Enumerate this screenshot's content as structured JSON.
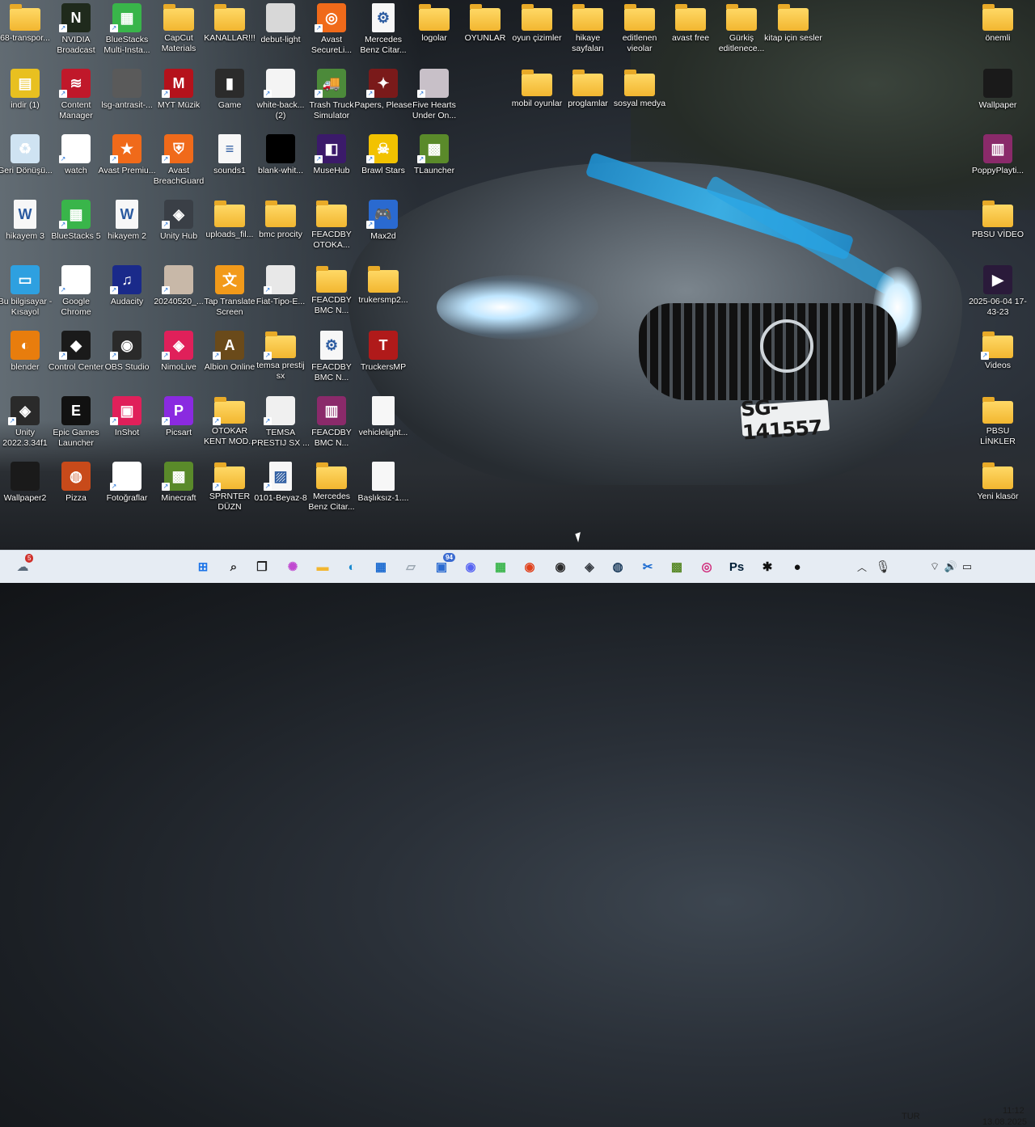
{
  "desktop": {
    "icons": [
      {
        "label": "68-transpor...",
        "kind": "folder",
        "bg": "#f2b630",
        "symbol": ""
      },
      {
        "label": "NVIDIA Broadcast",
        "kind": "app",
        "bg": "#1f2a1c",
        "symbol": "N"
      },
      {
        "label": "BlueStacks Multi-Insta...",
        "kind": "app",
        "bg": "#39b54a",
        "symbol": "▦"
      },
      {
        "label": "CapCut Materials",
        "kind": "folder",
        "bg": "#f2b630",
        "symbol": ""
      },
      {
        "label": "KANALLAR!!!",
        "kind": "folder",
        "bg": "#f2b630",
        "symbol": ""
      },
      {
        "label": "debut-light",
        "kind": "app",
        "bg": "#d8d8d8",
        "symbol": ""
      },
      {
        "label": "Avast SecureLi...",
        "kind": "app",
        "bg": "#f06a1a",
        "symbol": "◎"
      },
      {
        "label": "Mercedes Benz Citar...",
        "kind": "doc",
        "bg": "#f7f7f7",
        "symbol": "⚙"
      },
      {
        "label": "logolar",
        "kind": "folder",
        "bg": "#f2b630",
        "symbol": ""
      },
      {
        "label": "OYUNLAR",
        "kind": "folder",
        "bg": "#f2b630",
        "symbol": ""
      },
      {
        "label": "oyun çizimler",
        "kind": "folder",
        "bg": "#f2b630",
        "symbol": ""
      },
      {
        "label": "hikaye sayfaları",
        "kind": "folder",
        "bg": "#f2b630",
        "symbol": ""
      },
      {
        "label": "editlenen vieolar",
        "kind": "folder",
        "bg": "#f2b630",
        "symbol": ""
      },
      {
        "label": "avast free",
        "kind": "folder",
        "bg": "#f2b630",
        "symbol": ""
      },
      {
        "label": "Gürkiş editlenece...",
        "kind": "folder",
        "bg": "#f2b630",
        "symbol": ""
      },
      {
        "label": "kitap için sesler",
        "kind": "folder",
        "bg": "#f2b630",
        "symbol": ""
      },
      {
        "label": "önemli",
        "kind": "folder",
        "bg": "#f2b630",
        "symbol": ""
      },
      {
        "label": "indir (1)",
        "kind": "app",
        "bg": "#e8c020",
        "symbol": "▤"
      },
      {
        "label": "Content Manager",
        "kind": "app",
        "bg": "#c0182a",
        "symbol": "≋"
      },
      {
        "label": "lsg-antrasit-...",
        "kind": "app",
        "bg": "#5a5a5a",
        "symbol": ""
      },
      {
        "label": "MYT Müzik",
        "kind": "app",
        "bg": "#b5121b",
        "symbol": "M"
      },
      {
        "label": "Game",
        "kind": "app",
        "bg": "#2b2b2b",
        "symbol": "▮"
      },
      {
        "label": "white-back... (2)",
        "kind": "app",
        "bg": "#f4f4f4",
        "symbol": ""
      },
      {
        "label": "Trash Truck Simulator",
        "kind": "app",
        "bg": "#4c8a3a",
        "symbol": "🚚"
      },
      {
        "label": "Papers, Please",
        "kind": "app",
        "bg": "#7a1a1a",
        "symbol": "✦"
      },
      {
        "label": "Five Hearts Under On...",
        "kind": "app",
        "bg": "#c8c0c8",
        "symbol": ""
      },
      {
        "label": "mobil oyunlar",
        "kind": "folder",
        "bg": "#f2b630",
        "symbol": ""
      },
      {
        "label": "proglamlar",
        "kind": "folder",
        "bg": "#f2b630",
        "symbol": ""
      },
      {
        "label": "sosyal medya",
        "kind": "folder",
        "bg": "#f2b630",
        "symbol": ""
      },
      {
        "label": "Wallpaper",
        "kind": "app",
        "bg": "#1a1a1a",
        "symbol": ""
      },
      {
        "label": "Geri Dönüşü...",
        "kind": "app",
        "bg": "#cfe3f2",
        "symbol": "♻"
      },
      {
        "label": "watch",
        "kind": "app",
        "bg": "#ffffff",
        "symbol": "◉"
      },
      {
        "label": "Avast Premiu...",
        "kind": "app",
        "bg": "#f06a1a",
        "symbol": "★"
      },
      {
        "label": "Avast BreachGuard",
        "kind": "app",
        "bg": "#f06a1a",
        "symbol": "⛨"
      },
      {
        "label": "sounds1",
        "kind": "doc",
        "bg": "#f7f7f7",
        "symbol": "≡"
      },
      {
        "label": "blank-whit...",
        "kind": "app",
        "bg": "#000000",
        "symbol": ""
      },
      {
        "label": "MuseHub",
        "kind": "app",
        "bg": "#3b1a6a",
        "symbol": "◧"
      },
      {
        "label": "Brawl Stars",
        "kind": "app",
        "bg": "#f2c200",
        "symbol": "☠"
      },
      {
        "label": "TLauncher",
        "kind": "app",
        "bg": "#5a8a2a",
        "symbol": "▩"
      },
      {
        "label": "PoppyPlayti...",
        "kind": "app",
        "bg": "#8a2a6a",
        "symbol": "▥"
      },
      {
        "label": "hikayem 3",
        "kind": "doc",
        "bg": "#f7f7f7",
        "symbol": "W"
      },
      {
        "label": "BlueStacks 5",
        "kind": "app",
        "bg": "#39b54a",
        "symbol": "▦"
      },
      {
        "label": "hikayem 2",
        "kind": "doc",
        "bg": "#f7f7f7",
        "symbol": "W"
      },
      {
        "label": "Unity Hub",
        "kind": "app",
        "bg": "#3a3f46",
        "symbol": "◈"
      },
      {
        "label": "uploads_fil...",
        "kind": "folder",
        "bg": "#f2b630",
        "symbol": ""
      },
      {
        "label": "bmc procity",
        "kind": "folder",
        "bg": "#f2b630",
        "symbol": ""
      },
      {
        "label": "FEACDBY OTOKA...",
        "kind": "folder",
        "bg": "#f2b630",
        "symbol": ""
      },
      {
        "label": "Max2d",
        "kind": "app",
        "bg": "#2a6ad0",
        "symbol": "🎮"
      },
      {
        "label": "PBSU VİDEO",
        "kind": "folder",
        "bg": "#f2b630",
        "symbol": ""
      },
      {
        "label": "Bu bilgisayar - Kısayol",
        "kind": "app",
        "bg": "#2ea0e0",
        "symbol": "▭"
      },
      {
        "label": "Google Chrome",
        "kind": "app",
        "bg": "#ffffff",
        "symbol": "◉"
      },
      {
        "label": "Audacity",
        "kind": "app",
        "bg": "#1a2a8a",
        "symbol": "♫"
      },
      {
        "label": "20240520_...",
        "kind": "app",
        "bg": "#c8b8a8",
        "symbol": ""
      },
      {
        "label": "Tap Translate Screen",
        "kind": "app",
        "bg": "#f29a1a",
        "symbol": "文"
      },
      {
        "label": "Fiat-Tipo-E...",
        "kind": "app",
        "bg": "#e8e8e8",
        "symbol": ""
      },
      {
        "label": "FEACDBY BMC N...",
        "kind": "folder",
        "bg": "#f2b630",
        "symbol": ""
      },
      {
        "label": "trukersmp2...",
        "kind": "folder",
        "bg": "#f2b630",
        "symbol": ""
      },
      {
        "label": "2025-06-04 17-43-23",
        "kind": "app",
        "bg": "#2a1a3a",
        "symbol": "▶"
      },
      {
        "label": "blender",
        "kind": "app",
        "bg": "#e87d0d",
        "symbol": "◐"
      },
      {
        "label": "Control Center",
        "kind": "app",
        "bg": "#1a1a1a",
        "symbol": "◆"
      },
      {
        "label": "OBS Studio",
        "kind": "app",
        "bg": "#2a2a2a",
        "symbol": "◉"
      },
      {
        "label": "NimoLive",
        "kind": "app",
        "bg": "#e0205a",
        "symbol": "◈"
      },
      {
        "label": "Albion Online",
        "kind": "app",
        "bg": "#6a4a1a",
        "symbol": "A"
      },
      {
        "label": "temsa prestij sx",
        "kind": "folder",
        "bg": "#f2b630",
        "symbol": ""
      },
      {
        "label": "FEACDBY BMC N...",
        "kind": "doc",
        "bg": "#f7f7f7",
        "symbol": "⚙"
      },
      {
        "label": "TruckersMP",
        "kind": "app",
        "bg": "#b01a1a",
        "symbol": "T"
      },
      {
        "label": "Videos",
        "kind": "folder",
        "bg": "#f2b630",
        "symbol": ""
      },
      {
        "label": "Unity 2022.3.34f1",
        "kind": "app",
        "bg": "#2a2a2a",
        "symbol": "◈"
      },
      {
        "label": "Epic Games Launcher",
        "kind": "app",
        "bg": "#111111",
        "symbol": "E"
      },
      {
        "label": "InShot",
        "kind": "app",
        "bg": "#e0205a",
        "symbol": "▣"
      },
      {
        "label": "Picsart",
        "kind": "app",
        "bg": "#8a2ae0",
        "symbol": "P"
      },
      {
        "label": "OTOKAR KENT MOD...",
        "kind": "folder",
        "bg": "#f2b630",
        "symbol": ""
      },
      {
        "label": "TEMSA PRESTIJ SX ...",
        "kind": "app",
        "bg": "#f0f0f0",
        "symbol": ""
      },
      {
        "label": "FEACDBY BMC N...",
        "kind": "app",
        "bg": "#8a2a6a",
        "symbol": "▥"
      },
      {
        "label": "vehiclelight...",
        "kind": "doc",
        "bg": "#f7f7f7",
        "symbol": ""
      },
      {
        "label": "PBSU LİNKLER",
        "kind": "folder",
        "bg": "#f2b630",
        "symbol": ""
      },
      {
        "label": "Wallpaper2",
        "kind": "app",
        "bg": "#1a1a1a",
        "symbol": ""
      },
      {
        "label": "Pizza",
        "kind": "app",
        "bg": "#c84a1a",
        "symbol": "◍"
      },
      {
        "label": "Fotoğraflar",
        "kind": "app",
        "bg": "#ffffff",
        "symbol": "✿"
      },
      {
        "label": "Minecraft",
        "kind": "app",
        "bg": "#5a8a2a",
        "symbol": "▩"
      },
      {
        "label": "SPRNTER DÜZN",
        "kind": "folder",
        "bg": "#f2b630",
        "symbol": ""
      },
      {
        "label": "0101-Beyaz-8",
        "kind": "doc",
        "bg": "#f7f7f7",
        "symbol": "▨"
      },
      {
        "label": "Mercedes Benz Citar...",
        "kind": "folder",
        "bg": "#f2b630",
        "symbol": ""
      },
      {
        "label": "Başlıksız-1....",
        "kind": "doc",
        "bg": "#f7f7f7",
        "symbol": ""
      },
      {
        "label": "Yeni klasör",
        "kind": "folder",
        "bg": "#f2b630",
        "symbol": ""
      }
    ]
  },
  "wallpaper": {
    "plate": "SG-141557"
  },
  "taskbar": {
    "weather_badge": "5",
    "apps": [
      {
        "name": "start-icon",
        "symbol": "⊞",
        "color": "#1a73e8"
      },
      {
        "name": "search-icon",
        "symbol": "⌕",
        "color": "#222222"
      },
      {
        "name": "task-view-icon",
        "symbol": "❐",
        "color": "#222222"
      },
      {
        "name": "copilot-icon",
        "symbol": "✺",
        "color": "#c04ad0"
      },
      {
        "name": "file-explorer-icon",
        "symbol": "▬",
        "color": "#f2b630"
      },
      {
        "name": "edge-icon",
        "symbol": "◐",
        "color": "#1a8ad0"
      },
      {
        "name": "store-icon",
        "symbol": "▦",
        "color": "#1a6ad0"
      },
      {
        "name": "notepad-icon",
        "symbol": "▱",
        "color": "#9aa6b0"
      },
      {
        "name": "teams-icon",
        "symbol": "▣",
        "color": "#2a6ad0"
      },
      {
        "name": "discord-icon",
        "symbol": "◉",
        "color": "#5865f2"
      },
      {
        "name": "bluestacks-icon",
        "symbol": "▦",
        "color": "#39b54a"
      },
      {
        "name": "chrome-icon",
        "symbol": "◉",
        "color": "#e0401a"
      },
      {
        "name": "obs-icon",
        "symbol": "◉",
        "color": "#2a2a2a"
      },
      {
        "name": "unity-icon",
        "symbol": "◈",
        "color": "#3a3f46"
      },
      {
        "name": "steam-icon",
        "symbol": "◍",
        "color": "#1a3a5a"
      },
      {
        "name": "snipping-icon",
        "symbol": "✂",
        "color": "#1a6ad0"
      },
      {
        "name": "minecraft-icon",
        "symbol": "▩",
        "color": "#5a8a2a"
      },
      {
        "name": "instagram-icon",
        "symbol": "◎",
        "color": "#d02a7a"
      },
      {
        "name": "photoshop-icon",
        "symbol": "Ps",
        "color": "#001e36"
      },
      {
        "name": "chatgpt-icon",
        "symbol": "✱",
        "color": "#111111"
      },
      {
        "name": "github-copilot-icon",
        "symbol": "●",
        "color": "#111111"
      }
    ],
    "teams_badge": "94",
    "language": "TUR",
    "time": "11:12",
    "date": "13.08.2025"
  }
}
